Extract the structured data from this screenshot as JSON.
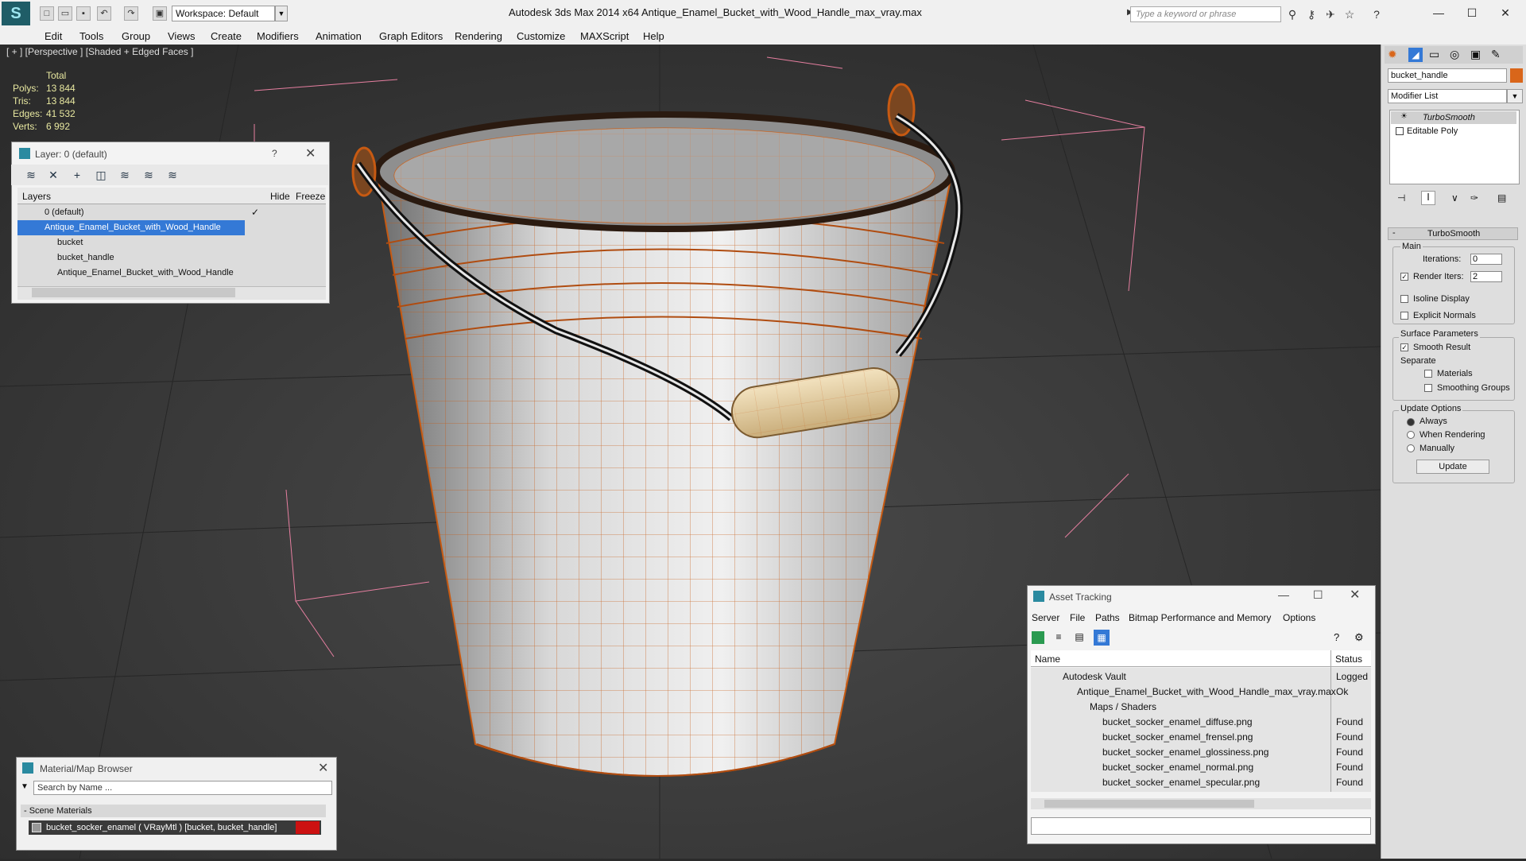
{
  "titlebar": {
    "app_title": "Autodesk 3ds Max  2014 x64      Antique_Enamel_Bucket_with_Wood_Handle_max_vray.max",
    "workspace": "Workspace: Default",
    "search_placeholder": "Type a keyword or phrase"
  },
  "menu": [
    "Edit",
    "Tools",
    "Group",
    "Views",
    "Create",
    "Modifiers",
    "Animation",
    "Graph Editors",
    "Rendering",
    "Customize",
    "MAXScript",
    "Help"
  ],
  "viewport": {
    "label": "[ + ] [Perspective ] [Shaded + Edged Faces ]",
    "stats": {
      "header": "Total",
      "rows": [
        {
          "label": "Polys:",
          "value": "13 844"
        },
        {
          "label": "Tris:",
          "value": "13 844"
        },
        {
          "label": "Edges:",
          "value": "41 532"
        },
        {
          "label": "Verts:",
          "value": "6 992"
        }
      ]
    }
  },
  "layer_window": {
    "title": "Layer: 0 (default)",
    "help": "?",
    "columns": [
      "Layers",
      "Hide",
      "Freeze"
    ],
    "rows": [
      {
        "name": "0 (default)"
      },
      {
        "name": "Antique_Enamel_Bucket_with_Wood_Handle"
      },
      {
        "name": "bucket"
      },
      {
        "name": "bucket_handle"
      },
      {
        "name": "Antique_Enamel_Bucket_with_Wood_Handle"
      }
    ]
  },
  "material_browser": {
    "title": "Material/Map Browser",
    "search_placeholder": "Search by Name ...",
    "section": "- Scene Materials",
    "item": "bucket_socker_enamel  ( VRayMtl )  [bucket, bucket_handle]"
  },
  "asset_tracking": {
    "title": "Asset Tracking",
    "menu": [
      "Server",
      "File",
      "Paths",
      "Bitmap Performance and Memory",
      "Options"
    ],
    "columns": [
      "Name",
      "Status"
    ],
    "rows": [
      {
        "name": "Autodesk Vault",
        "status": "Logged"
      },
      {
        "name": "Antique_Enamel_Bucket_with_Wood_Handle_max_vray.max",
        "status": "Ok"
      },
      {
        "name": "Maps / Shaders",
        "status": ""
      },
      {
        "name": "bucket_socker_enamel_diffuse.png",
        "status": "Found"
      },
      {
        "name": "bucket_socker_enamel_frensel.png",
        "status": "Found"
      },
      {
        "name": "bucket_socker_enamel_glossiness.png",
        "status": "Found"
      },
      {
        "name": "bucket_socker_enamel_normal.png",
        "status": "Found"
      },
      {
        "name": "bucket_socker_enamel_specular.png",
        "status": "Found"
      }
    ]
  },
  "command_panel": {
    "object_name": "bucket_handle",
    "modifier_list": "Modifier List",
    "stack": [
      "TurboSmooth",
      "Editable Poly"
    ],
    "rollout_title": "TurboSmooth",
    "main": "Main",
    "iterations_label": "Iterations:",
    "iterations_value": "0",
    "render_iters_label": "Render Iters:",
    "render_iters_value": "2",
    "isoline": "Isoline Display",
    "explicit_normals": "Explicit Normals",
    "surface_params": "Surface Parameters",
    "smooth_result": "Smooth Result",
    "separate": "Separate",
    "materials": "Materials",
    "smoothing_groups": "Smoothing Groups",
    "update_options": "Update Options",
    "always": "Always",
    "when_rendering": "When Rendering",
    "manually": "Manually",
    "update_button": "Update"
  },
  "colors": {
    "accent_orange": "#d9661a",
    "selection_blue": "#3479d6",
    "material_red": "#cc1111"
  }
}
